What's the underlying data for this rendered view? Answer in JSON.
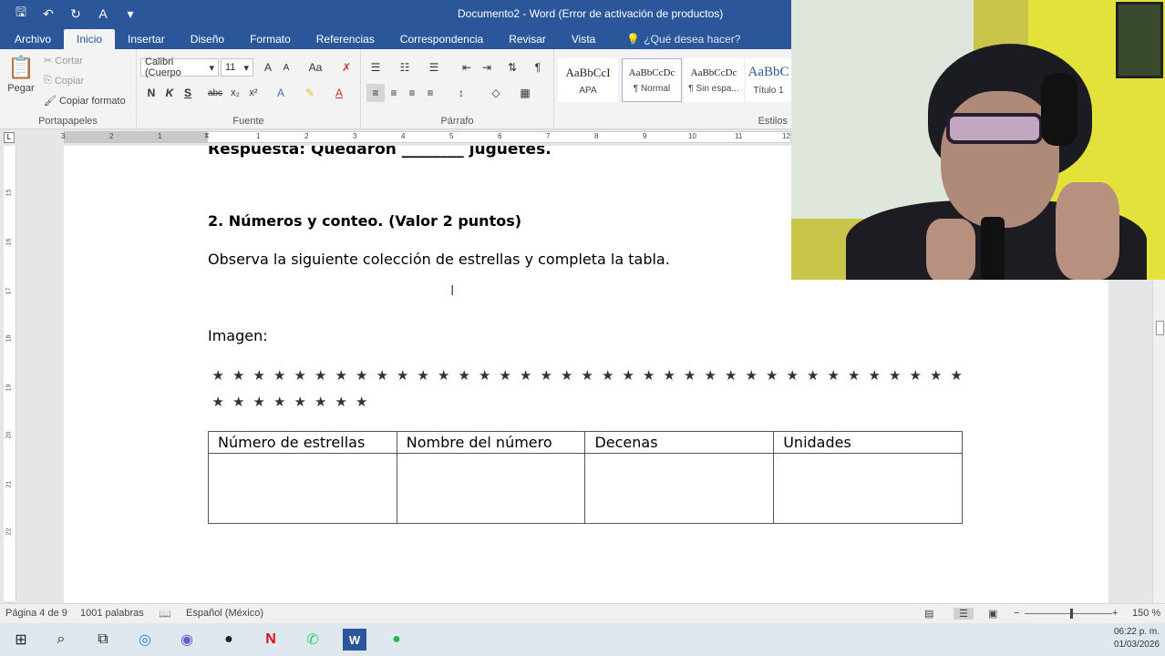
{
  "window": {
    "title": "Documento2 - Word (Error de activación de productos)"
  },
  "ribbon_tabs": [
    "Archivo",
    "Inicio",
    "Insertar",
    "Diseño",
    "Formato",
    "Referencias",
    "Correspondencia",
    "Revisar",
    "Vista"
  ],
  "search_placeholder": "¿Qué desea hacer?",
  "clipboard": {
    "paste": "Pegar",
    "cut": "Cortar",
    "copy": "Copiar",
    "format_painter": "Copiar formato",
    "label": "Portapapeles"
  },
  "font": {
    "family": "Calibri (Cuerpo",
    "size": "11",
    "bold": "N",
    "italic": "K",
    "underline": "S",
    "strike": "abc",
    "subscript": "x₂",
    "superscript": "x²",
    "change_case": "Aa",
    "label": "Fuente"
  },
  "paragraph": {
    "label": "Párrafo"
  },
  "styles": {
    "items": [
      {
        "sample": "AaBbCcI",
        "name": "APA"
      },
      {
        "sample": "AaBbCcDc",
        "name": "¶ Normal"
      },
      {
        "sample": "AaBbCcDc",
        "name": "¶ Sin espa..."
      },
      {
        "sample": "AaBbC",
        "name": "Título 1"
      }
    ],
    "label": "Estilos"
  },
  "ruler": {
    "numbers": [
      "3",
      "2",
      "1",
      "1",
      "2",
      "3",
      "4",
      "5",
      "6",
      "7",
      "8",
      "9",
      "10",
      "11",
      "12"
    ]
  },
  "vruler": {
    "numbers": [
      "15",
      "16",
      "17",
      "18",
      "19",
      "20",
      "21",
      "22"
    ]
  },
  "document": {
    "partial_line": "Respuesta: Quedaron ________ juguetes.",
    "section_title": "2. Números y conteo. (Valor 2 puntos)",
    "instruction": "Observa la siguiente colección de estrellas y completa la tabla.",
    "image_label": "Imagen:",
    "star_glyph": "★",
    "stars_row1_count": 37,
    "stars_row2_count": 8,
    "table": {
      "headers": [
        "Número de estrellas",
        "Nombre del número",
        "Decenas",
        "Unidades"
      ],
      "rows": [
        [
          "",
          "",
          "",
          ""
        ]
      ]
    }
  },
  "status": {
    "page": "Página 4 de 9",
    "words": "1001 palabras",
    "language": "Español (México)",
    "zoom": "150 %"
  },
  "taskbar": {
    "time": "06:22 p. m.",
    "date": "01/03/2026"
  }
}
